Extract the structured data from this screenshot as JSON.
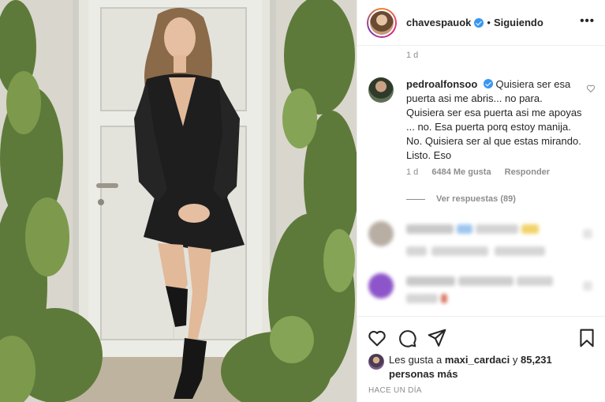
{
  "post": {
    "author": "chavespauok",
    "follow_status": "Siguiendo",
    "separator": "•",
    "more_label": "•••"
  },
  "comments": {
    "previous_age": "1 d",
    "featured": {
      "user": "pedroalfonsoo",
      "text": "Quisiera ser esa puerta asi me abris... no para. Quisiera ser esa puerta asi me apoyas ... no. Esa puerta porq estoy manija. No. Quisiera ser al que estas mirando. Listo. Eso",
      "age": "1 d",
      "likes": "6484 Me gusta",
      "reply_label": "Responder",
      "view_replies": "Ver respuestas (89)"
    }
  },
  "likes": {
    "prefix": "Les gusta a",
    "user": "maxi_cardaci",
    "joiner": "y",
    "count": "85,231 personas más"
  },
  "post_age": "HACE UN DÍA",
  "icons": {
    "like": "heart-icon",
    "comment": "comment-icon",
    "share": "share-icon",
    "save": "bookmark-icon",
    "verified": "verified-badge-icon"
  },
  "colors": {
    "verified": "#3897f0",
    "text": "#262626",
    "muted": "#8e8e8e",
    "divider": "#efefef"
  }
}
